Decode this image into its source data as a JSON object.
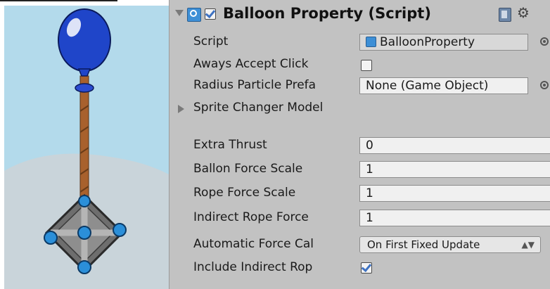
{
  "component": {
    "title": "Balloon Property (Script)",
    "enabled": true,
    "icons": {
      "fold": "foldout-open-icon",
      "script": "script-icon",
      "help": "help-book-icon",
      "settings": "gear-icon"
    }
  },
  "properties": {
    "script": {
      "label": "Script",
      "value": "BalloonProperty"
    },
    "aways_accept_click": {
      "label": "Aways Accept Click",
      "checked": false
    },
    "radius_particle_prefab": {
      "label": "Radius Particle Prefa",
      "value": "None (Game Object)"
    },
    "sprite_changer_model": {
      "label": "Sprite Changer Model"
    },
    "extra_thrust": {
      "label": "Extra Thrust",
      "value": "0"
    },
    "ballon_force_scale": {
      "label": "Ballon Force Scale",
      "value": "1"
    },
    "rope_force_scale": {
      "label": "Rope Force Scale",
      "value": "1"
    },
    "indirect_rope_force": {
      "label": "Indirect Rope Force",
      "value": "1"
    },
    "automatic_force_calc": {
      "label": "Automatic Force Cal",
      "value": "On First Fixed Update"
    },
    "include_indirect_rope": {
      "label": "Include Indirect Rop",
      "checked": true
    }
  },
  "colors": {
    "inspector_bg": "#c2c2c2",
    "balloon": "#1f45c9",
    "rope": "#a8612d",
    "crate": "#7b7b7b",
    "bolt": "#2b8fd9",
    "sky": "#b3daeb",
    "hill": "#c9d4da"
  }
}
